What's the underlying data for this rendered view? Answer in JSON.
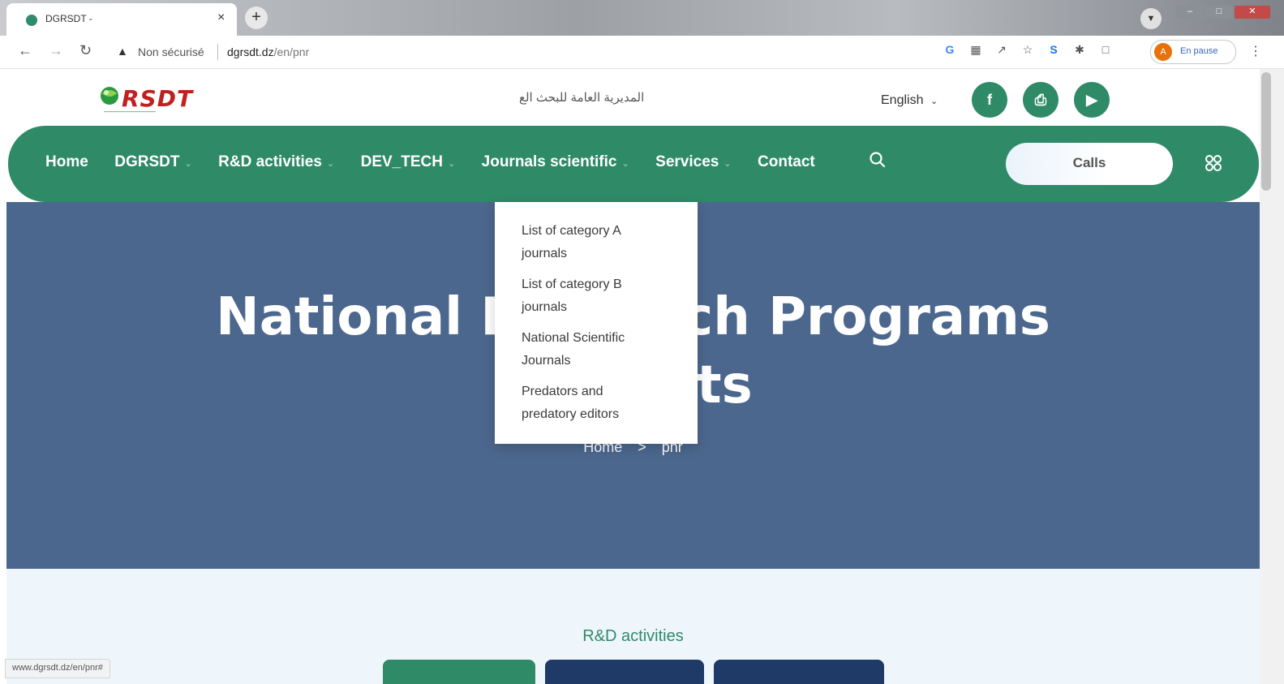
{
  "browser": {
    "tab_title": "DGRSDT -",
    "tab_close": "×",
    "new_tab": "+",
    "security_label": "Non sécurisé",
    "url_host": "dgrsdt.dz",
    "url_path": "/en/pnr",
    "profile_initial": "A",
    "profile_status": "En pause",
    "status_url": "www.dgrsdt.dz/en/pnr#"
  },
  "header": {
    "logo_text": "RSDT",
    "arabic_title": "المديرية العامة للبحث الع",
    "language": "English"
  },
  "nav": {
    "items": [
      {
        "label": "Home",
        "has_caret": false
      },
      {
        "label": "DGRSDT",
        "has_caret": true
      },
      {
        "label": "R&D activities",
        "has_caret": true
      },
      {
        "label": "DEV_TECH",
        "has_caret": true
      },
      {
        "label": "Journals scientific",
        "has_caret": true
      },
      {
        "label": "Services",
        "has_caret": true
      },
      {
        "label": "Contact",
        "has_caret": false
      }
    ],
    "calls_label": "Calls"
  },
  "dropdown": {
    "items": [
      {
        "line1": "List of category A",
        "line2": "journals"
      },
      {
        "line1": "List of category B",
        "line2": "journals"
      },
      {
        "line1": "National Scientific",
        "line2": "Journals"
      },
      {
        "line1": "Predators and",
        "line2": "predatory editors"
      }
    ]
  },
  "hero": {
    "title_line1": "National Research Programs",
    "title_line2": "Projects",
    "crumb_home": "Home",
    "crumb_sep": ">",
    "crumb_current": "pnr"
  },
  "section": {
    "heading": "R&D activities"
  },
  "colors": {
    "brand_green": "#2f8a68",
    "hero_blue": "#4c678d",
    "pill_dark": "#1f3a66"
  }
}
